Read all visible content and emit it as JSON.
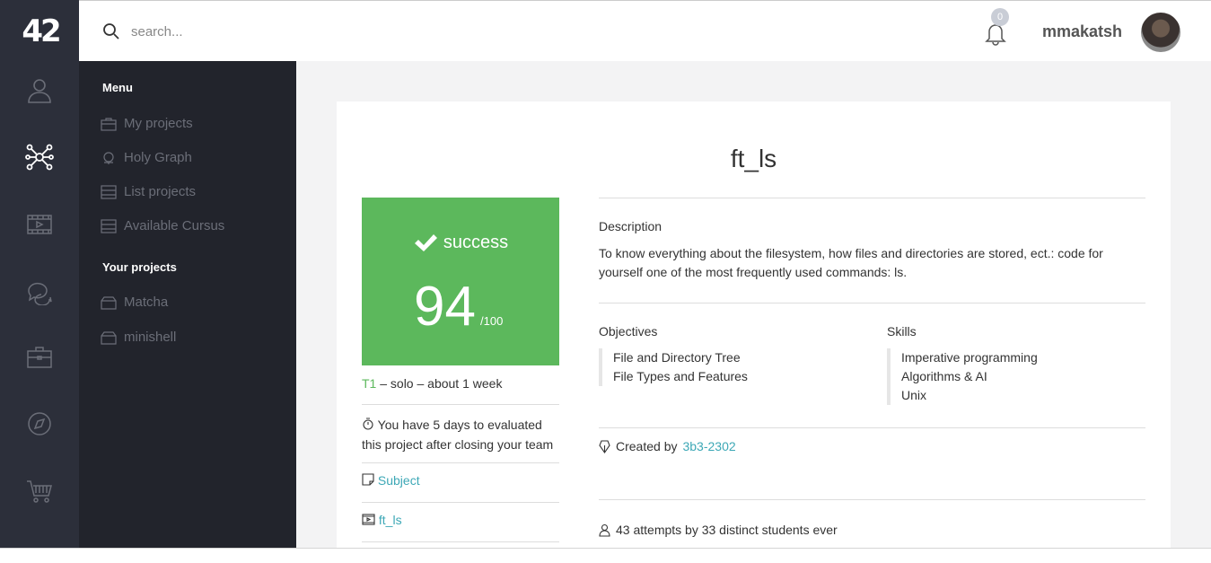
{
  "app": {
    "logo_text": "42"
  },
  "rail": {
    "icons": [
      "user-icon",
      "graph-network-icon",
      "video-icon",
      "chat-icon",
      "briefcase-icon",
      "compass-icon",
      "cart-icon"
    ]
  },
  "submenu": {
    "menu_heading": "Menu",
    "menu_items": [
      "My projects",
      "Holy Graph",
      "List projects",
      "Available Cursus"
    ],
    "projects_heading": "Your projects",
    "project_items": [
      "Matcha",
      "minishell"
    ]
  },
  "topbar": {
    "search_placeholder": "search...",
    "notification_count": "0",
    "username": "mmakatsh"
  },
  "project": {
    "title": "ft_ls",
    "status": "success",
    "mark": "94",
    "out_of": "/100",
    "tier": "T1",
    "tier_details": " – solo – about 1 week",
    "deadline_note": "You have 5 days to evaluated this project after closing your team",
    "subject_link": "Subject",
    "repo_link": "ft_ls",
    "description_label": "Description",
    "description": "To know everything about the filesystem, how files and directories are stored, ect.: code for yourself one of the most frequently used commands: ls.",
    "objectives_label": "Objectives",
    "objectives": [
      "File and Directory Tree",
      "File Types and Features"
    ],
    "skills_label": "Skills",
    "skills": [
      "Imperative programming",
      "Algorithms & AI",
      "Unix"
    ],
    "created_by_prefix": "Created by",
    "creator": "3b3-2302",
    "attempts": "43 attempts by 33 distinct students ever"
  },
  "colors": {
    "success": "#5cb85c",
    "link": "#3da8b6",
    "sidebar": "#2c2f3a",
    "submenu": "#22242c"
  }
}
